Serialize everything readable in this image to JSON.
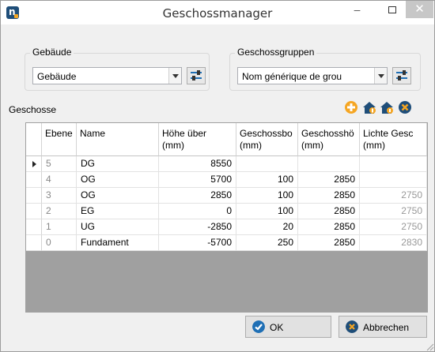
{
  "window": {
    "title": "Geschossmanager"
  },
  "titlebar": {
    "minimize": "–",
    "close": "✕"
  },
  "gebaeude": {
    "label": "Gebäude",
    "selected": "Gebäude"
  },
  "geschossgruppen": {
    "label": "Geschossgruppen",
    "selected": "Nom générique de grou"
  },
  "geschosse": {
    "label": "Geschosse",
    "columns": [
      "Ebene",
      "Name",
      "Höhe über\n(mm)",
      "Geschossbo\n(mm)",
      "Geschosshö\n(mm)",
      "Lichte Gesc\n(mm)"
    ],
    "rows": [
      {
        "level": "5",
        "name": "DG",
        "hoehe": "8550",
        "boden": "",
        "geschosshoehe": "",
        "lichte": ""
      },
      {
        "level": "4",
        "name": "OG",
        "hoehe": "5700",
        "boden": "100",
        "geschosshoehe": "2850",
        "lichte": ""
      },
      {
        "level": "3",
        "name": "OG",
        "hoehe": "2850",
        "boden": "100",
        "geschosshoehe": "2850",
        "lichte": "2750"
      },
      {
        "level": "2",
        "name": "EG",
        "hoehe": "0",
        "boden": "100",
        "geschosshoehe": "2850",
        "lichte": "2750"
      },
      {
        "level": "1",
        "name": "UG",
        "hoehe": "-2850",
        "boden": "20",
        "geschosshoehe": "2850",
        "lichte": "2750"
      },
      {
        "level": "0",
        "name": "Fundament",
        "hoehe": "-5700",
        "boden": "250",
        "geschosshoehe": "2850",
        "lichte": "2830"
      }
    ]
  },
  "buttons": {
    "ok": "OK",
    "cancel": "Abbrechen"
  },
  "colors": {
    "accent_orange": "#f5a623",
    "accent_blue": "#1f4e79",
    "ok_blue": "#1f6fb5",
    "cancel_blue": "#1f4e79"
  }
}
